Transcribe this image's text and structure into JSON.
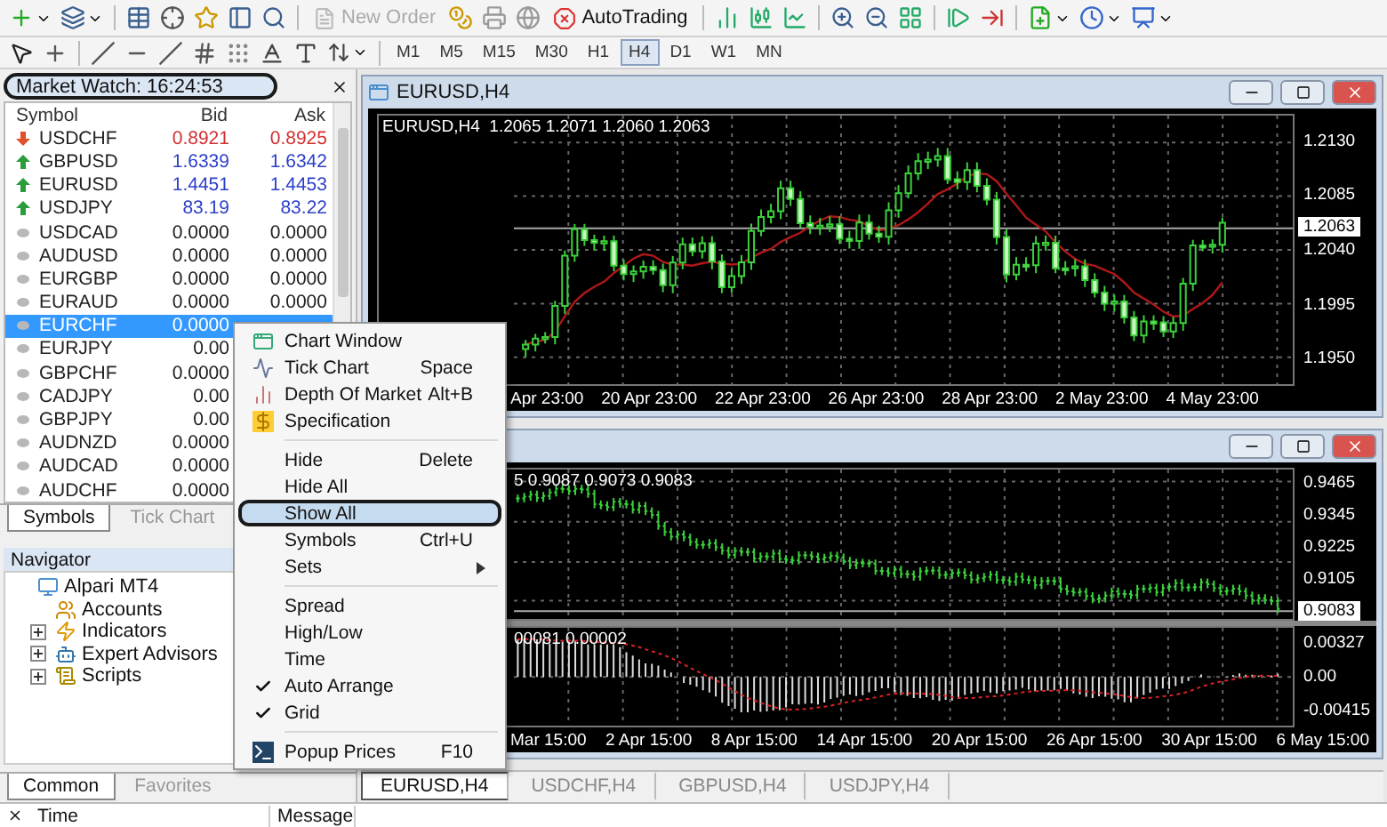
{
  "toolbar": {
    "new_order": {
      "label": "New Order",
      "disabled": true
    },
    "autotrading": {
      "label": "AutoTrading"
    }
  },
  "timeframes": [
    {
      "label": "M1",
      "selected": false
    },
    {
      "label": "M5",
      "selected": false
    },
    {
      "label": "M15",
      "selected": false
    },
    {
      "label": "M30",
      "selected": false
    },
    {
      "label": "H1",
      "selected": false
    },
    {
      "label": "H4",
      "selected": true
    },
    {
      "label": "D1",
      "selected": false
    },
    {
      "label": "W1",
      "selected": false
    },
    {
      "label": "MN",
      "selected": false
    }
  ],
  "market_watch": {
    "title": "Market Watch: 16:24:53",
    "title_circled": true,
    "columns": [
      "Symbol",
      "Bid",
      "Ask"
    ],
    "rows": [
      {
        "symbol": "USDCHF",
        "bid": "0.8921",
        "ask": "0.8925",
        "quoted": true,
        "rising": false,
        "selected": false
      },
      {
        "symbol": "GBPUSD",
        "bid": "1.6339",
        "ask": "1.6342",
        "quoted": true,
        "rising": true,
        "selected": false
      },
      {
        "symbol": "EURUSD",
        "bid": "1.4451",
        "ask": "1.4453",
        "quoted": true,
        "rising": true,
        "selected": false
      },
      {
        "symbol": "USDJPY",
        "bid": "83.19",
        "ask": "83.22",
        "quoted": true,
        "rising": true,
        "selected": false
      },
      {
        "symbol": "USDCAD",
        "bid": "0.0000",
        "ask": "0.0000",
        "quoted": false,
        "selected": false
      },
      {
        "symbol": "AUDUSD",
        "bid": "0.0000",
        "ask": "0.0000",
        "quoted": false,
        "selected": false
      },
      {
        "symbol": "EURGBP",
        "bid": "0.0000",
        "ask": "0.0000",
        "quoted": false,
        "selected": false
      },
      {
        "symbol": "EURAUD",
        "bid": "0.0000",
        "ask": "0.0000",
        "quoted": false,
        "selected": false
      },
      {
        "symbol": "EURCHF",
        "bid": "0.0000",
        "quoted": false,
        "selected": true
      },
      {
        "symbol": "EURJPY",
        "bid": "0.00",
        "quoted": false,
        "selected": false
      },
      {
        "symbol": "GBPCHF",
        "bid": "0.0000",
        "quoted": false,
        "selected": false
      },
      {
        "symbol": "CADJPY",
        "bid": "0.00",
        "quoted": false,
        "selected": false
      },
      {
        "symbol": "GBPJPY",
        "bid": "0.00",
        "quoted": false,
        "selected": false
      },
      {
        "symbol": "AUDNZD",
        "bid": "0.0000",
        "quoted": false,
        "selected": false
      },
      {
        "symbol": "AUDCAD",
        "bid": "0.0000",
        "quoted": false,
        "selected": false
      },
      {
        "symbol": "AUDCHF",
        "bid": "0.0000",
        "quoted": false,
        "selected": false
      }
    ],
    "tabs": [
      {
        "label": "Symbols",
        "selected": true
      },
      {
        "label": "Tick Chart",
        "selected": false
      }
    ]
  },
  "navigator": {
    "title": "Navigator",
    "tree": [
      {
        "label": "Alpari MT4",
        "expandable": false,
        "children": [
          {
            "label": "Accounts",
            "expandable": false
          },
          {
            "label": "Indicators",
            "expandable": true,
            "expanded": false
          },
          {
            "label": "Expert Advisors",
            "expandable": true,
            "expanded": false
          },
          {
            "label": "Scripts",
            "expandable": true,
            "expanded": false
          }
        ]
      }
    ],
    "tabs": [
      {
        "label": "Common",
        "selected": true
      },
      {
        "label": "Favorites",
        "selected": false
      }
    ]
  },
  "context_menu": [
    {
      "kind": "command",
      "label": "Chart Window",
      "has_icon": true,
      "selected": false,
      "circled": false
    },
    {
      "kind": "command",
      "label": "Tick Chart",
      "shortcut": "Space",
      "has_icon": true,
      "selected": false,
      "circled": false
    },
    {
      "kind": "command",
      "label": "Depth Of Market",
      "shortcut": "Alt+B",
      "has_icon": true,
      "selected": false,
      "circled": false
    },
    {
      "kind": "command",
      "label": "Specification",
      "has_icon": true,
      "selected": false,
      "circled": false
    },
    {
      "kind": "separator"
    },
    {
      "kind": "command",
      "label": "Hide",
      "shortcut": "Delete",
      "has_icon": false,
      "selected": false,
      "circled": false
    },
    {
      "kind": "command",
      "label": "Hide All",
      "has_icon": false,
      "selected": false,
      "circled": false
    },
    {
      "kind": "command",
      "label": "Show All",
      "has_icon": false,
      "selected": true,
      "circled": true
    },
    {
      "kind": "command",
      "label": "Symbols",
      "shortcut": "Ctrl+U",
      "has_icon": false,
      "selected": false,
      "circled": false
    },
    {
      "kind": "submenu",
      "label": "Sets",
      "selected": false,
      "circled": false
    },
    {
      "kind": "separator"
    },
    {
      "kind": "toggle",
      "label": "Spread",
      "checked": false,
      "selected": false,
      "circled": false
    },
    {
      "kind": "toggle",
      "label": "High/Low",
      "checked": false,
      "selected": false,
      "circled": false
    },
    {
      "kind": "toggle",
      "label": "Time",
      "checked": false,
      "selected": false,
      "circled": false
    },
    {
      "kind": "toggle",
      "label": "Auto Arrange",
      "checked": true,
      "selected": false,
      "circled": false
    },
    {
      "kind": "toggle",
      "label": "Grid",
      "checked": true,
      "selected": false,
      "circled": false
    },
    {
      "kind": "separator"
    },
    {
      "kind": "command",
      "label": "Popup Prices",
      "shortcut": "F10",
      "has_icon": true,
      "selected": false,
      "circled": false
    }
  ],
  "charts": [
    {
      "title": "EURUSD,H4",
      "panes": [
        {
          "kind": "candles",
          "info": "EURUSD,H4  1.2065 1.2071 1.2060 1.2063",
          "price_labels": [
            "1.2130",
            "1.2085",
            "1.2040",
            "1.1995",
            "1.1950"
          ],
          "current_price": "1.2063"
        }
      ],
      "time_labels": [
        "Apr 23:00",
        "20 Apr 23:00",
        "22 Apr 23:00",
        "26 Apr 23:00",
        "28 Apr 23:00",
        "2 May 23:00",
        "4 May 23:00"
      ]
    },
    {
      "panes": [
        {
          "kind": "bars",
          "info": "5 0.9087 0.9073 0.9083",
          "price_labels": [
            "0.9465",
            "0.9345",
            "0.9225",
            "0.9105"
          ],
          "current_price": "0.9083"
        },
        {
          "kind": "histogram",
          "info": "00081 0.00002",
          "price_labels": [
            "0.00327",
            "0.00",
            "-0.00415"
          ]
        }
      ],
      "time_labels": [
        "Mar 15:00",
        "2 Apr 15:00",
        "8 Apr 15:00",
        "14 Apr 15:00",
        "20 Apr 15:00",
        "26 Apr 15:00",
        "30 Apr 15:00",
        "6 May 15:00"
      ]
    }
  ],
  "chart_tabs": [
    {
      "label": "EURUSD,H4",
      "selected": true
    },
    {
      "label": "USDCHF,H4",
      "selected": false
    },
    {
      "label": "GBPUSD,H4",
      "selected": false
    },
    {
      "label": "USDJPY,H4",
      "selected": false
    }
  ],
  "terminal": {
    "columns": [
      "Time",
      "Message"
    ]
  }
}
